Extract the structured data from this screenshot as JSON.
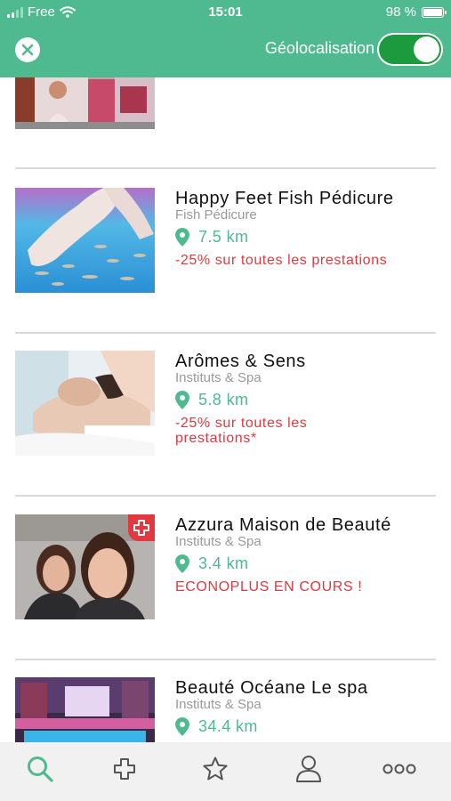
{
  "status_bar": {
    "carrier": "Free",
    "time": "15:01",
    "battery_text": "98 %",
    "battery_level": 0.98
  },
  "header": {
    "geolocation_label": "Géolocalisation",
    "geolocation_enabled": true,
    "accent_color": "#4fba8f",
    "toggle_color": "#1b9a3e"
  },
  "listings": [
    {
      "name": "Happy Feet Fish Pédicure",
      "category": "Fish Pédicure",
      "distance": "7.5 km",
      "promo": "-25% sur toutes les prestations",
      "badge": ""
    },
    {
      "name": "Arômes & Sens",
      "category": "Instituts & Spa",
      "distance": "5.8 km",
      "promo": "-25% sur toutes les prestations*",
      "badge": ""
    },
    {
      "name": "Azzura Maison de Beauté",
      "category": "Instituts & Spa",
      "distance": "3.4 km",
      "promo": "ECONOPLUS EN COURS !",
      "badge": "plus-icon"
    },
    {
      "name": "Beauté Océane Le spa",
      "category": "Instituts & Spa",
      "distance": "34.4 km",
      "promo": "",
      "badge": ""
    }
  ],
  "colors": {
    "distance": "#4fba8f",
    "promo": "#e2383f",
    "category": "#9a9a9a"
  },
  "tab_bar": {
    "icons": [
      "search-icon",
      "cross-icon",
      "star-icon",
      "user-icon",
      "more-icon"
    ],
    "active": "search-icon"
  }
}
